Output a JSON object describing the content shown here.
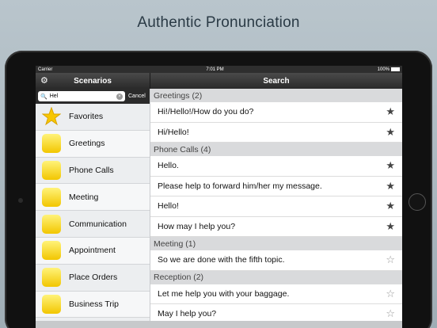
{
  "headline": "Authentic Pronunciation",
  "status": {
    "carrier": "Carrier",
    "time": "7:01 PM",
    "battery": "100%"
  },
  "nav": {
    "left_title": "Scenarios",
    "right_title": "Search"
  },
  "search": {
    "value": "Hel",
    "cancel": "Cancel"
  },
  "categories": [
    {
      "label": "Favorites",
      "icon": "star-icon"
    },
    {
      "label": "Greetings",
      "icon": "greetings-icon"
    },
    {
      "label": "Phone Calls",
      "icon": "phone-calls-icon"
    },
    {
      "label": "Meeting",
      "icon": "meeting-icon"
    },
    {
      "label": "Communication",
      "icon": "communication-icon"
    },
    {
      "label": "Appointment",
      "icon": "appointment-icon"
    },
    {
      "label": "Place Orders",
      "icon": "place-orders-icon"
    },
    {
      "label": "Business Trip",
      "icon": "business-trip-icon"
    }
  ],
  "sections": [
    {
      "header": "Greetings (2)",
      "rows": [
        {
          "text": "Hi!/Hello!/How do you do?",
          "starred": true
        },
        {
          "text": "Hi/Hello!",
          "starred": true
        }
      ]
    },
    {
      "header": "Phone Calls (4)",
      "rows": [
        {
          "text": "Hello.",
          "starred": true
        },
        {
          "text": "Please help to forward him/her my message.",
          "starred": true
        },
        {
          "text": "Hello!",
          "starred": true
        },
        {
          "text": "How may I help you?",
          "starred": true
        }
      ]
    },
    {
      "header": "Meeting (1)",
      "rows": [
        {
          "text": "So we are done with the fifth topic.",
          "starred": false
        }
      ]
    },
    {
      "header": "Reception (2)",
      "rows": [
        {
          "text": "Let me help you with your baggage.",
          "starred": false
        },
        {
          "text": "May I help you?",
          "starred": false
        }
      ]
    }
  ]
}
